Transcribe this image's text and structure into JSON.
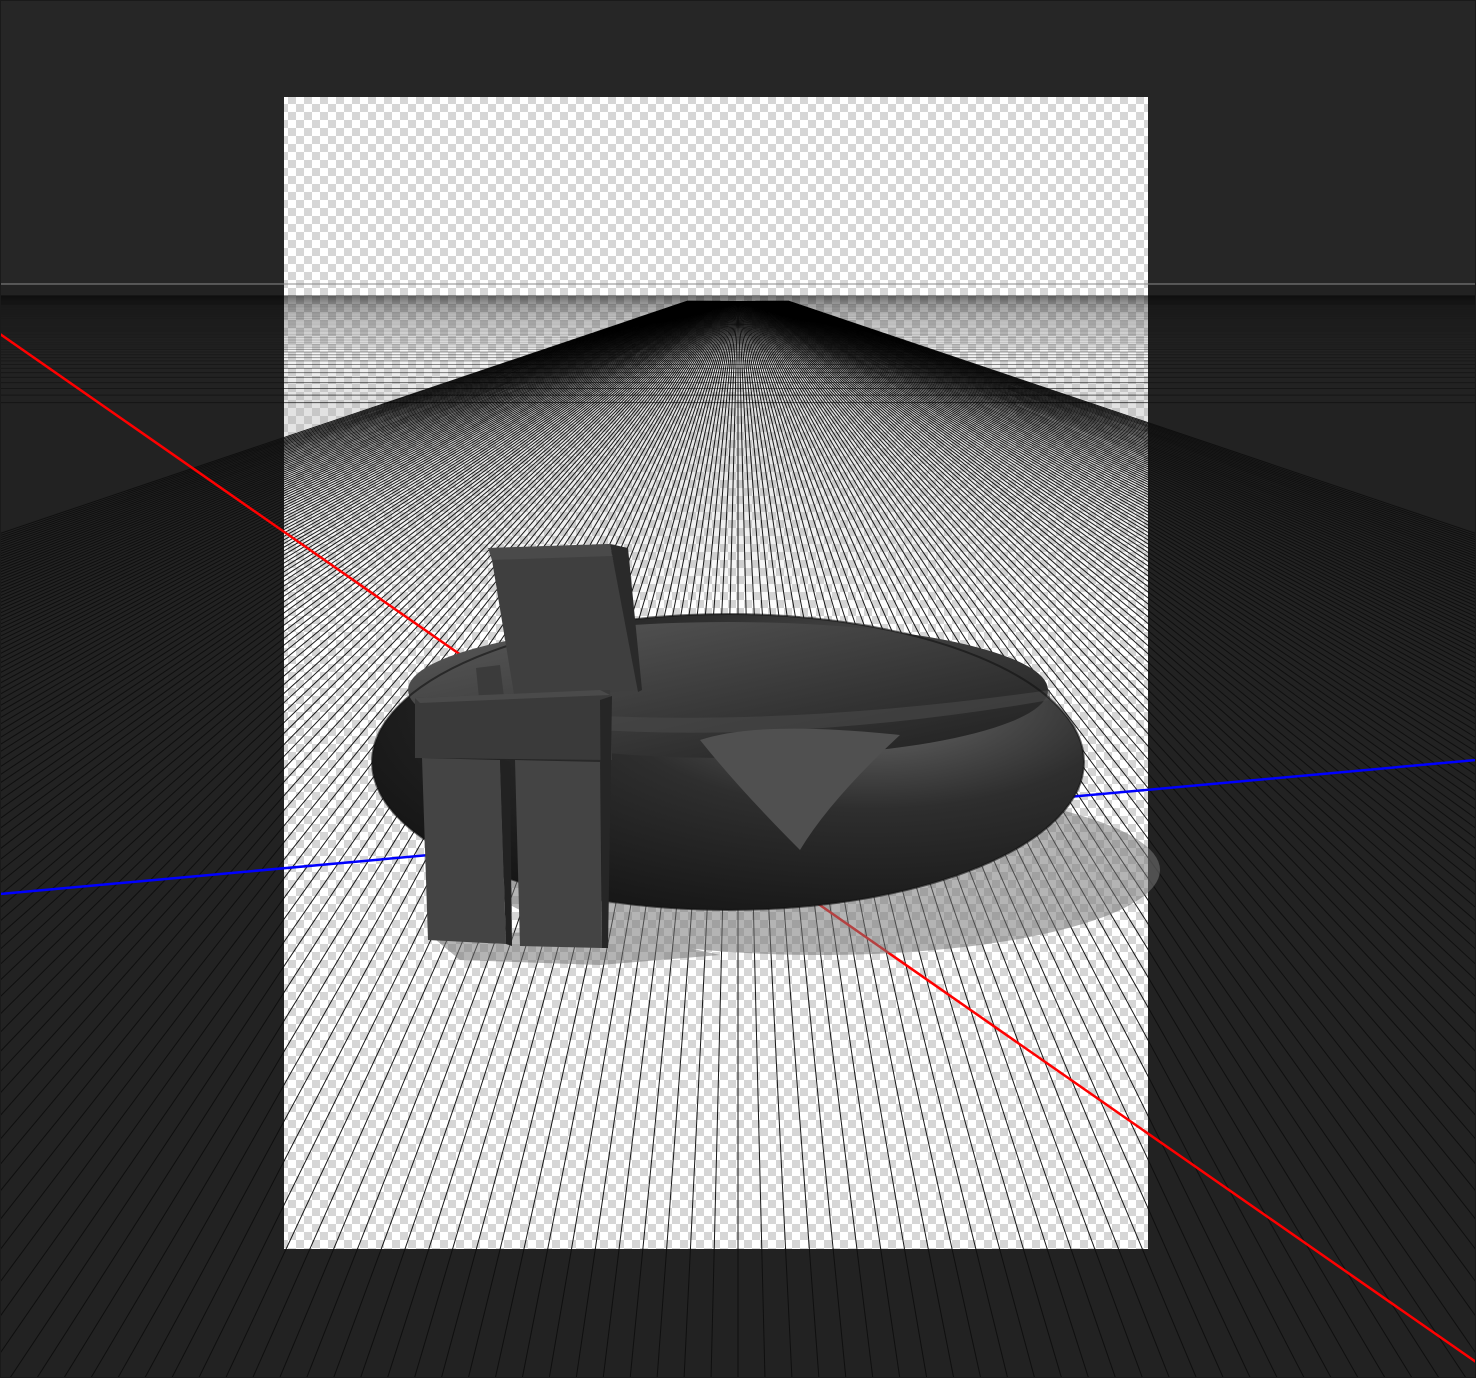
{
  "scene": {
    "background_color": "#262626",
    "floor_color": "#222222",
    "grid_line_color": "#0d0d0d",
    "canvas_grid_line_color": "#000000",
    "horizon_line_color": "#8a8a8a",
    "checker_light": "#ffffff",
    "checker_dark": "#d6d6d6",
    "axis_x_color": "#ff0000",
    "axis_z_color": "#0000ff",
    "ring_color": "#2b2b2b",
    "figure_color": "#3f3f3f"
  },
  "objects": [
    {
      "name": "ring",
      "icon": "torus-icon"
    },
    {
      "name": "blocky-figure",
      "icon": "cube-figure-icon"
    }
  ]
}
